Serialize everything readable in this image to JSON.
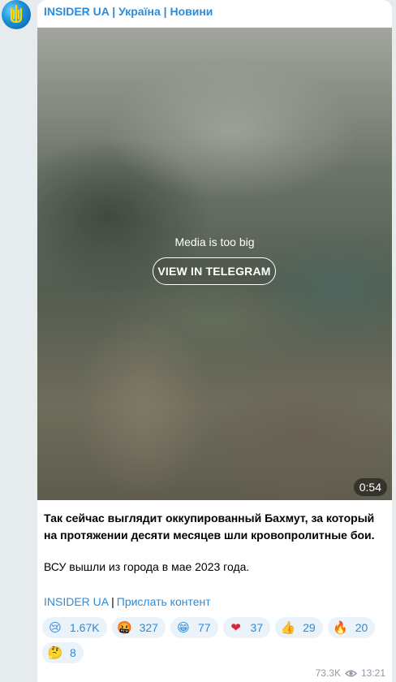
{
  "channel": {
    "title": "INSIDER UA | Україна | Новини"
  },
  "media": {
    "notice": "Media is too big",
    "button_label": "VIEW IN TELEGRAM",
    "duration": "0:54"
  },
  "post": {
    "paragraph1": "Так сейчас выглядит оккупированный Бахмут, за который на протяжении десяти месяцев шли кровопролитные бои.",
    "paragraph2": "ВСУ вышли из города в мае 2023 года.",
    "link1": "INSIDER UA",
    "separator": "|",
    "link2": "Прислать контент"
  },
  "reactions": [
    {
      "icon": "crying-face-icon",
      "glyph": "😢",
      "count": "1.67K",
      "color": "#f2b200"
    },
    {
      "icon": "angry-face-icon",
      "glyph": "🤬",
      "count": "327",
      "color": "#d9472b"
    },
    {
      "icon": "grinning-face-icon",
      "glyph": "😁",
      "count": "77",
      "color": "#f2b200"
    },
    {
      "icon": "red-heart-icon",
      "glyph": "❤",
      "count": "37",
      "color": "#e0243a"
    },
    {
      "icon": "thumbs-up-icon",
      "glyph": "👍",
      "count": "29",
      "color": "#f2b200"
    },
    {
      "icon": "fire-icon",
      "glyph": "🔥",
      "count": "20",
      "color": "#f26a1b"
    },
    {
      "icon": "thinking-face-icon",
      "glyph": "🤔",
      "count": "8",
      "color": "#f2b200"
    }
  ],
  "footer": {
    "views": "73.3K",
    "time": "13:21"
  },
  "colors": {
    "accent": "#2f8ad6",
    "reaction_bg": "#eaf2fa",
    "page_bg": "#e6ebee"
  }
}
